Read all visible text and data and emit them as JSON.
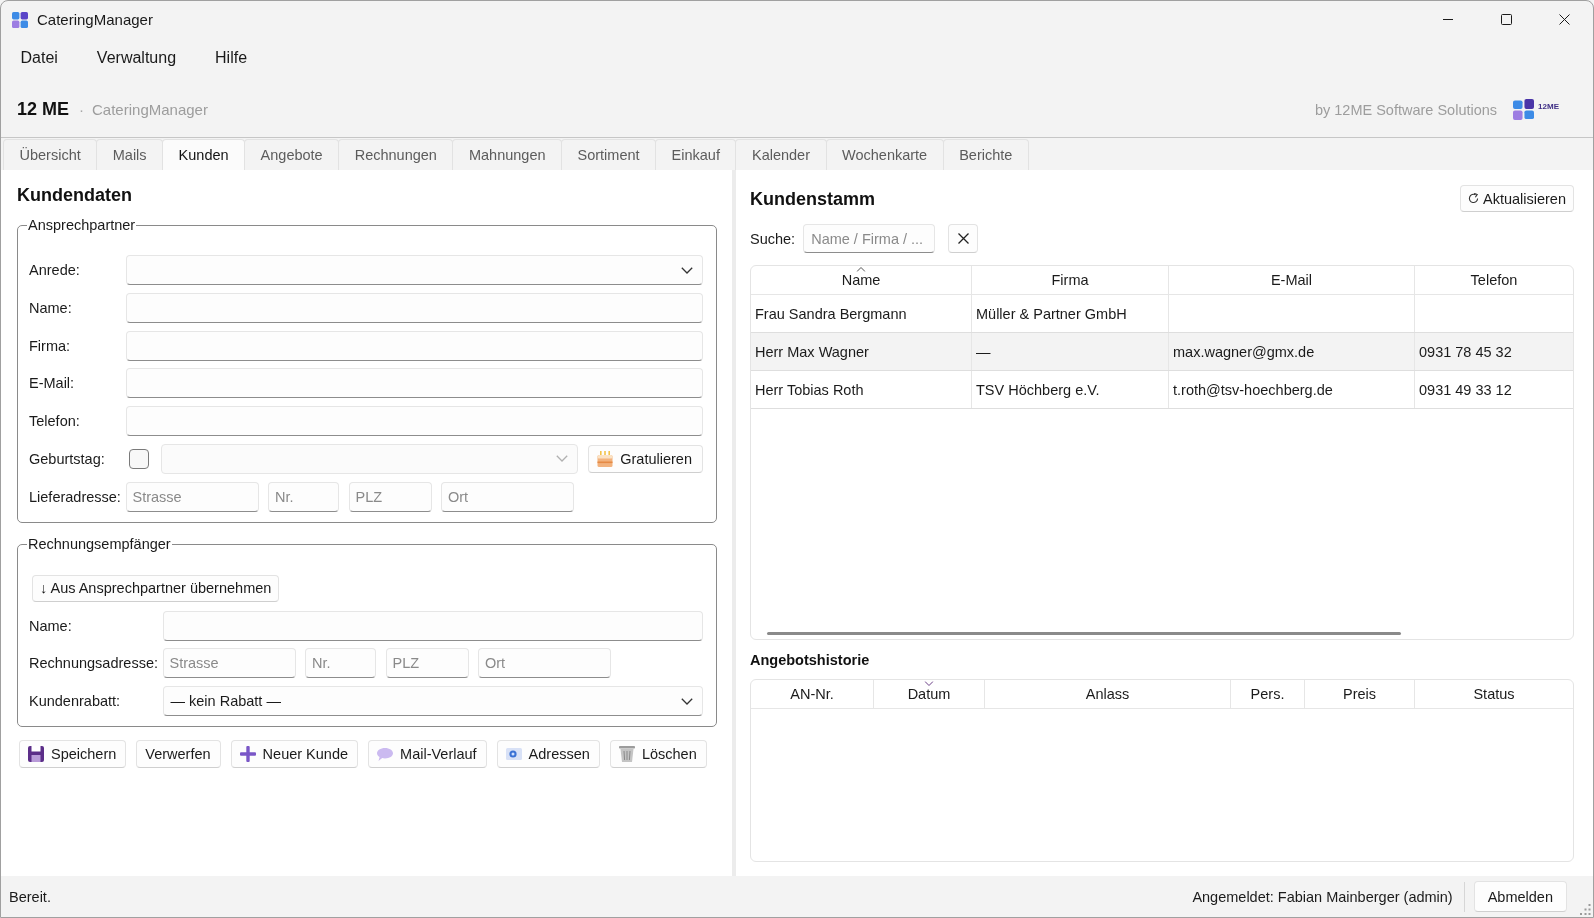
{
  "window": {
    "title": "CateringManager"
  },
  "menu": [
    "Datei",
    "Verwaltung",
    "Hilfe"
  ],
  "header": {
    "brand": "12 ME",
    "separator": "·",
    "app_name": "CateringManager",
    "vendor": "by 12ME Software Solutions",
    "logo_text": "12ME"
  },
  "tabs": [
    {
      "label": "Übersicht",
      "selected": false
    },
    {
      "label": "Mails",
      "selected": false
    },
    {
      "label": "Kunden",
      "selected": true
    },
    {
      "label": "Angebote",
      "selected": false
    },
    {
      "label": "Rechnungen",
      "selected": false
    },
    {
      "label": "Mahnungen",
      "selected": false
    },
    {
      "label": "Sortiment",
      "selected": false
    },
    {
      "label": "Einkauf",
      "selected": false
    },
    {
      "label": "Kalender",
      "selected": false
    },
    {
      "label": "Wochenkarte",
      "selected": false
    },
    {
      "label": "Berichte",
      "selected": false
    }
  ],
  "customer_form": {
    "title": "Kundendaten",
    "contact": {
      "legend": "Ansprechpartner",
      "fields": [
        {
          "kind": "select",
          "label": "Anrede:"
        },
        {
          "kind": "text",
          "label": "Name:"
        },
        {
          "kind": "text",
          "label": "Firma:"
        },
        {
          "kind": "text",
          "label": "E-Mail:"
        },
        {
          "kind": "text",
          "label": "Telefon:"
        },
        {
          "kind": "birthday",
          "label": "Geburtstag:",
          "checked": false,
          "button": "Gratulieren"
        },
        {
          "kind": "address",
          "label": "Lieferadresse:",
          "placeholders": [
            "Strasse",
            "Nr.",
            "PLZ",
            "Ort"
          ]
        }
      ]
    },
    "billing": {
      "legend": "Rechnungsempfänger",
      "copy_button": "↓ Aus Ansprechpartner übernehmen",
      "fields": [
        {
          "kind": "text",
          "label": "Name:"
        },
        {
          "kind": "address",
          "label": "Rechnungsadresse:",
          "placeholders": [
            "Strasse",
            "Nr.",
            "PLZ",
            "Ort"
          ]
        },
        {
          "kind": "select",
          "label": "Kundenrabatt:",
          "value": "— kein Rabatt —"
        }
      ]
    },
    "actions": [
      {
        "kind": "save",
        "label": "Speichern"
      },
      {
        "kind": "plain",
        "label": "Verwerfen"
      },
      {
        "kind": "new",
        "label": "Neuer Kunde"
      },
      {
        "kind": "mail",
        "label": "Mail-Verlauf"
      },
      {
        "kind": "addresses",
        "label": "Adressen"
      },
      {
        "kind": "delete",
        "label": "Löschen"
      }
    ]
  },
  "customer_list": {
    "title": "Kundenstamm",
    "refresh_button": "Aktualisieren",
    "search": {
      "label": "Suche:",
      "placeholder": "Name / Firma / ..."
    },
    "table": {
      "columns": [
        {
          "label": "Name",
          "sorted": true,
          "descending": false
        },
        {
          "label": "Firma",
          "sorted": false
        },
        {
          "label": "E-Mail",
          "sorted": false
        },
        {
          "label": "Telefon",
          "sorted": false
        }
      ],
      "rows": [
        {
          "name": "Frau Sandra Bergmann",
          "company": "Müller & Partner GmbH",
          "selected": false
        },
        {
          "name": "Herr Max Wagner",
          "company": "—",
          "email": "max.wagner@gmx.de",
          "phone": "0931 78 45 32",
          "selected": true
        },
        {
          "name": "Herr Tobias Roth",
          "company": "TSV Höchberg e.V.",
          "email": "t.roth@tsv-hoechberg.de",
          "phone": "0931 49 33 12",
          "selected": false
        }
      ]
    }
  },
  "offer_history": {
    "title": "Angebotshistorie",
    "columns": [
      {
        "label": "AN-Nr.",
        "sorted": false
      },
      {
        "label": "Datum",
        "sorted": true,
        "descending": true
      },
      {
        "label": "Anlass",
        "sorted": false
      },
      {
        "label": "Pers.",
        "sorted": false
      },
      {
        "label": "Preis",
        "sorted": false
      },
      {
        "label": "Status",
        "sorted": false
      }
    ]
  },
  "status_bar": {
    "message": "Bereit.",
    "user": "Angemeldet: Fabian Mainberger (admin)",
    "logout_button": "Abmelden"
  }
}
